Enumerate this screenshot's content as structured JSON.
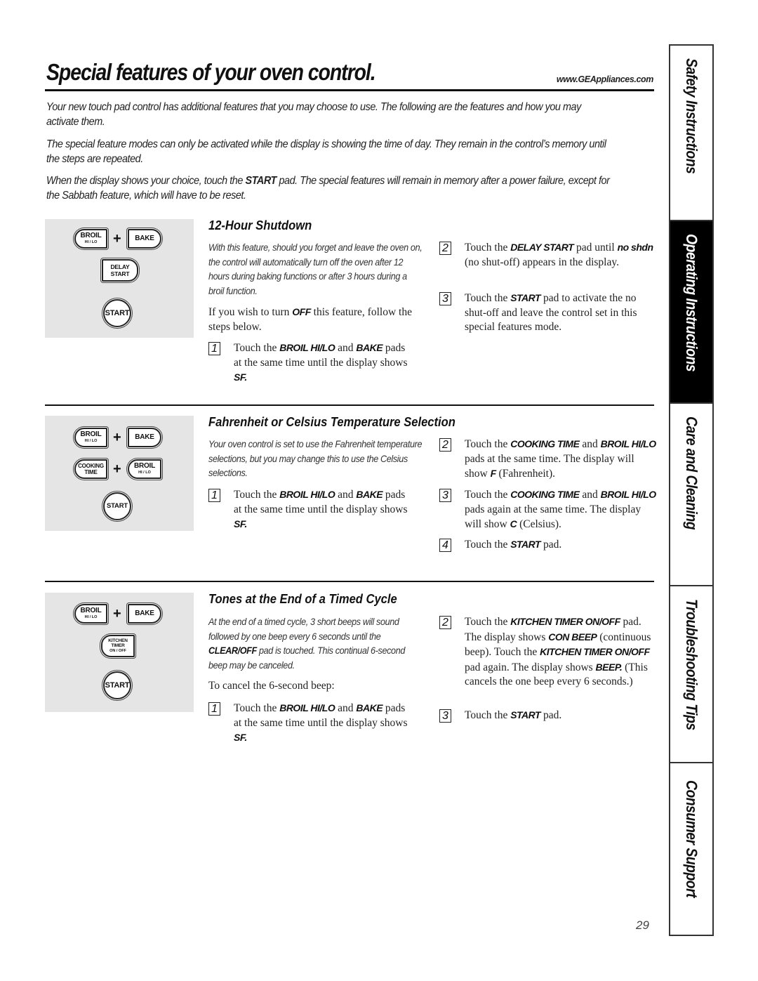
{
  "header": {
    "title": "Special features of your oven control.",
    "url": "www.GEAppliances.com"
  },
  "intro": {
    "p1": "Your new touch pad control has additional features that you may choose to use. The following are the features and how you may activate them.",
    "p2": "The special feature modes can only be activated while the display is showing the time of day. They remain in the control’s memory until the steps are repeated.",
    "p3_before": "When the display shows your choice, touch the ",
    "p3_kw": "START",
    "p3_after": " pad. The special features will remain in memory after a power failure, except for the Sabbath feature, which will have to be reset."
  },
  "pads": {
    "broil": "BROIL",
    "hilo": "HI / LO",
    "bake": "BAKE",
    "delay": "DELAY",
    "start_word": "START",
    "cooking": "COOKING",
    "time": "TIME",
    "kitchen": "KITCHEN",
    "timer": "TIMER",
    "onoff": "ON / OFF",
    "start": "START",
    "plus": "+"
  },
  "sections": [
    {
      "heading": "12-Hour Shutdown",
      "description": "With this feature, should you forget and leave the oven on, the control will automatically turn off the oven after 12 hours during baking functions or after 3 hours during a broil function.",
      "note_before": "If you wish to turn ",
      "note_kw": "OFF",
      "note_after": " this feature, follow the steps below.",
      "steps": [
        {
          "num": "1",
          "t1": "Touch the ",
          "k1": "BROIL HI/LO",
          "t2": " and ",
          "k2": "BAKE",
          "t3": " pads at the same time until the display shows ",
          "k3": "SF."
        },
        {
          "num": "2",
          "t1": "Touch the ",
          "k1": "DELAY START",
          "t2": " pad until ",
          "k2": "no shdn",
          "t3": " (no shut-off) appears in the display."
        },
        {
          "num": "3",
          "t1": "Touch the ",
          "k1": "START",
          "t2": " pad to activate the no shut-off and leave the control set in this special features mode."
        }
      ]
    },
    {
      "heading": "Fahrenheit or Celsius Temperature Selection",
      "description": "Your oven control is set to use the Fahrenheit temperature selections, but you may change this to use the Celsius selections.",
      "steps": [
        {
          "num": "1",
          "t1": "Touch the ",
          "k1": "BROIL HI/LO",
          "t2": " and ",
          "k2": "BAKE",
          "t3": " pads at the same time until the display shows ",
          "k3": "SF."
        },
        {
          "num": "2",
          "t1": "Touch the ",
          "k1": "COOKING TIME",
          "t2": " and ",
          "k2": "BROIL HI/LO",
          "t3": " pads at the same time. The display will show ",
          "k3": "F",
          "t4": " (Fahrenheit)."
        },
        {
          "num": "3",
          "t1": "Touch the ",
          "k1": "COOKING TIME",
          "t2": " and ",
          "k2": "BROIL HI/LO",
          "t3": " pads again at the same time. The display will show ",
          "k3": "C",
          "t4": " (Celsius)."
        },
        {
          "num": "4",
          "t1": "Touch the ",
          "k1": "START",
          "t2": " pad."
        }
      ]
    },
    {
      "heading": "Tones at the End of a Timed Cycle",
      "description_before": "At the end of a timed cycle, 3 short beeps will sound followed by one beep every 6 seconds until the ",
      "description_kw": "CLEAR/OFF",
      "description_after": " pad is touched. This continual 6-second beep may be canceled.",
      "note": "To cancel the 6-second beep:",
      "steps": [
        {
          "num": "1",
          "t1": "Touch the ",
          "k1": "BROIL HI/LO",
          "t2": " and ",
          "k2": "BAKE",
          "t3": " pads at the same time until the display shows ",
          "k3": "SF."
        },
        {
          "num": "2",
          "t1": "Touch the ",
          "k1": "KITCHEN TIMER ON/OFF",
          "t2": " pad. The display shows ",
          "k2": "CON BEEP",
          "t3": " (continuous beep). Touch the ",
          "k3": "KITCHEN TIMER ON/OFF",
          "t4": " pad again. The display shows ",
          "k4": "BEEP.",
          "t5": " (This cancels the one beep every 6 seconds.)"
        },
        {
          "num": "3",
          "t1": "Touch the ",
          "k1": "START",
          "t2": " pad."
        }
      ]
    }
  ],
  "tabs": [
    {
      "label": "Safety Instructions",
      "active": false
    },
    {
      "label": "Operating Instructions",
      "active": true
    },
    {
      "label": "Care and Cleaning",
      "active": false
    },
    {
      "label": "Troubleshooting Tips",
      "active": false
    },
    {
      "label": "Consumer Support",
      "active": false
    }
  ],
  "page_number": "29"
}
